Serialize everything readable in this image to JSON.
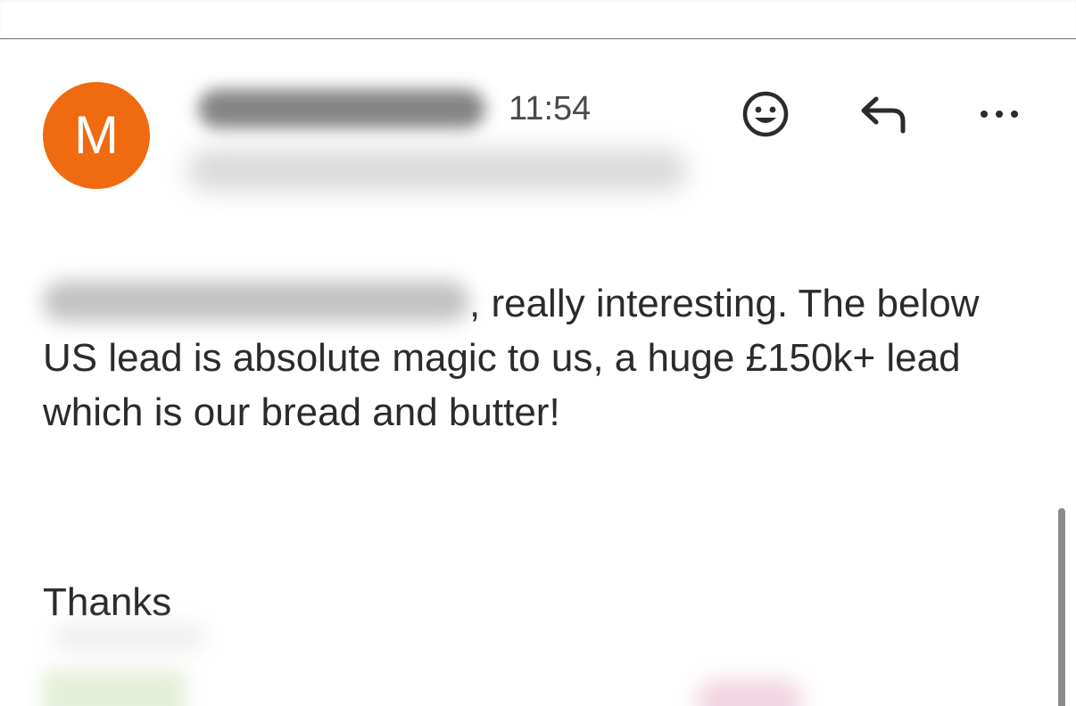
{
  "message": {
    "avatar_initial": "M",
    "time": "11:54",
    "body_text": ", really interesting. The below US lead is absolute magic to us, a huge £150k+ lead which is our bread and butter!",
    "closing": "Thanks"
  },
  "icons": {
    "emoji": "emoji-icon",
    "reply": "reply-icon",
    "more": "more-icon"
  },
  "colors": {
    "avatar_bg": "#f06a0f",
    "text": "#2b2b2b"
  }
}
